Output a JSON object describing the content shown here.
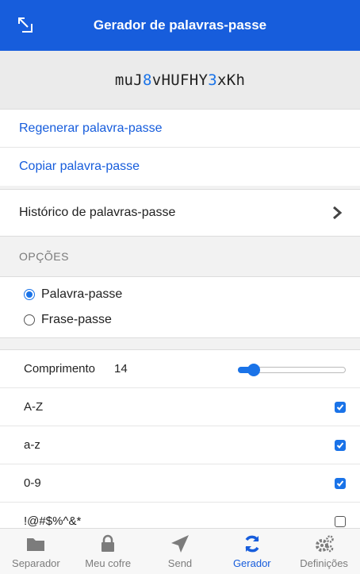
{
  "header": {
    "title": "Gerador de palavras-passe"
  },
  "password": {
    "part1": "muJ",
    "digit1": "8",
    "part2": "vHUFHY",
    "digit2": "3",
    "part3": "xKh"
  },
  "actions": {
    "regenerate": "Regenerar palavra-passe",
    "copy": "Copiar palavra-passe"
  },
  "history": {
    "label": "Histórico de palavras-passe"
  },
  "options": {
    "section_label": "OPÇÕES",
    "type_options": [
      {
        "label": "Palavra-passe",
        "selected": true
      },
      {
        "label": "Frase-passe",
        "selected": false
      }
    ],
    "length_label": "Comprimento",
    "length_value": "14",
    "length_level": 0.12,
    "toggles": [
      {
        "label": "A-Z",
        "checked": true
      },
      {
        "label": "a-z",
        "checked": true
      },
      {
        "label": "0-9",
        "checked": true
      },
      {
        "label": "!@#$%^&*",
        "checked": false
      }
    ]
  },
  "tabs": [
    {
      "label": "Separador",
      "icon": "folder-icon"
    },
    {
      "label": "Meu cofre",
      "icon": "lock-icon"
    },
    {
      "label": "Send",
      "icon": "send-icon"
    },
    {
      "label": "Gerador",
      "icon": "refresh-icon",
      "active": true
    },
    {
      "label": "Definições",
      "icon": "gears-icon"
    }
  ],
  "colors": {
    "accent": "#175ddc",
    "digit": "#1a73e8"
  }
}
